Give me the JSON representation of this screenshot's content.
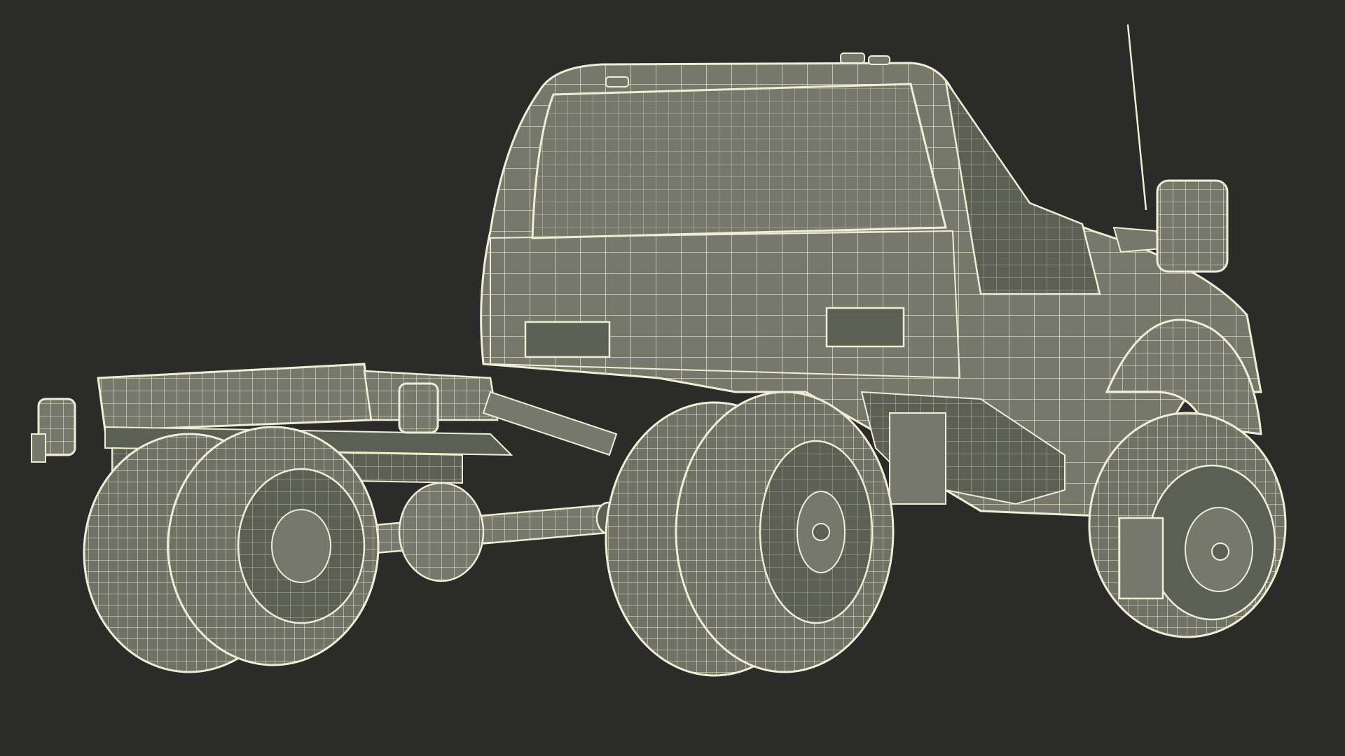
{
  "scene": {
    "subject": "wireframe-truck-chassis-cab",
    "colors": {
      "background": "#2b2b2a",
      "surface": "#75786a",
      "surface_shadow": "#5c5f53",
      "wire": "#efedd6"
    }
  }
}
